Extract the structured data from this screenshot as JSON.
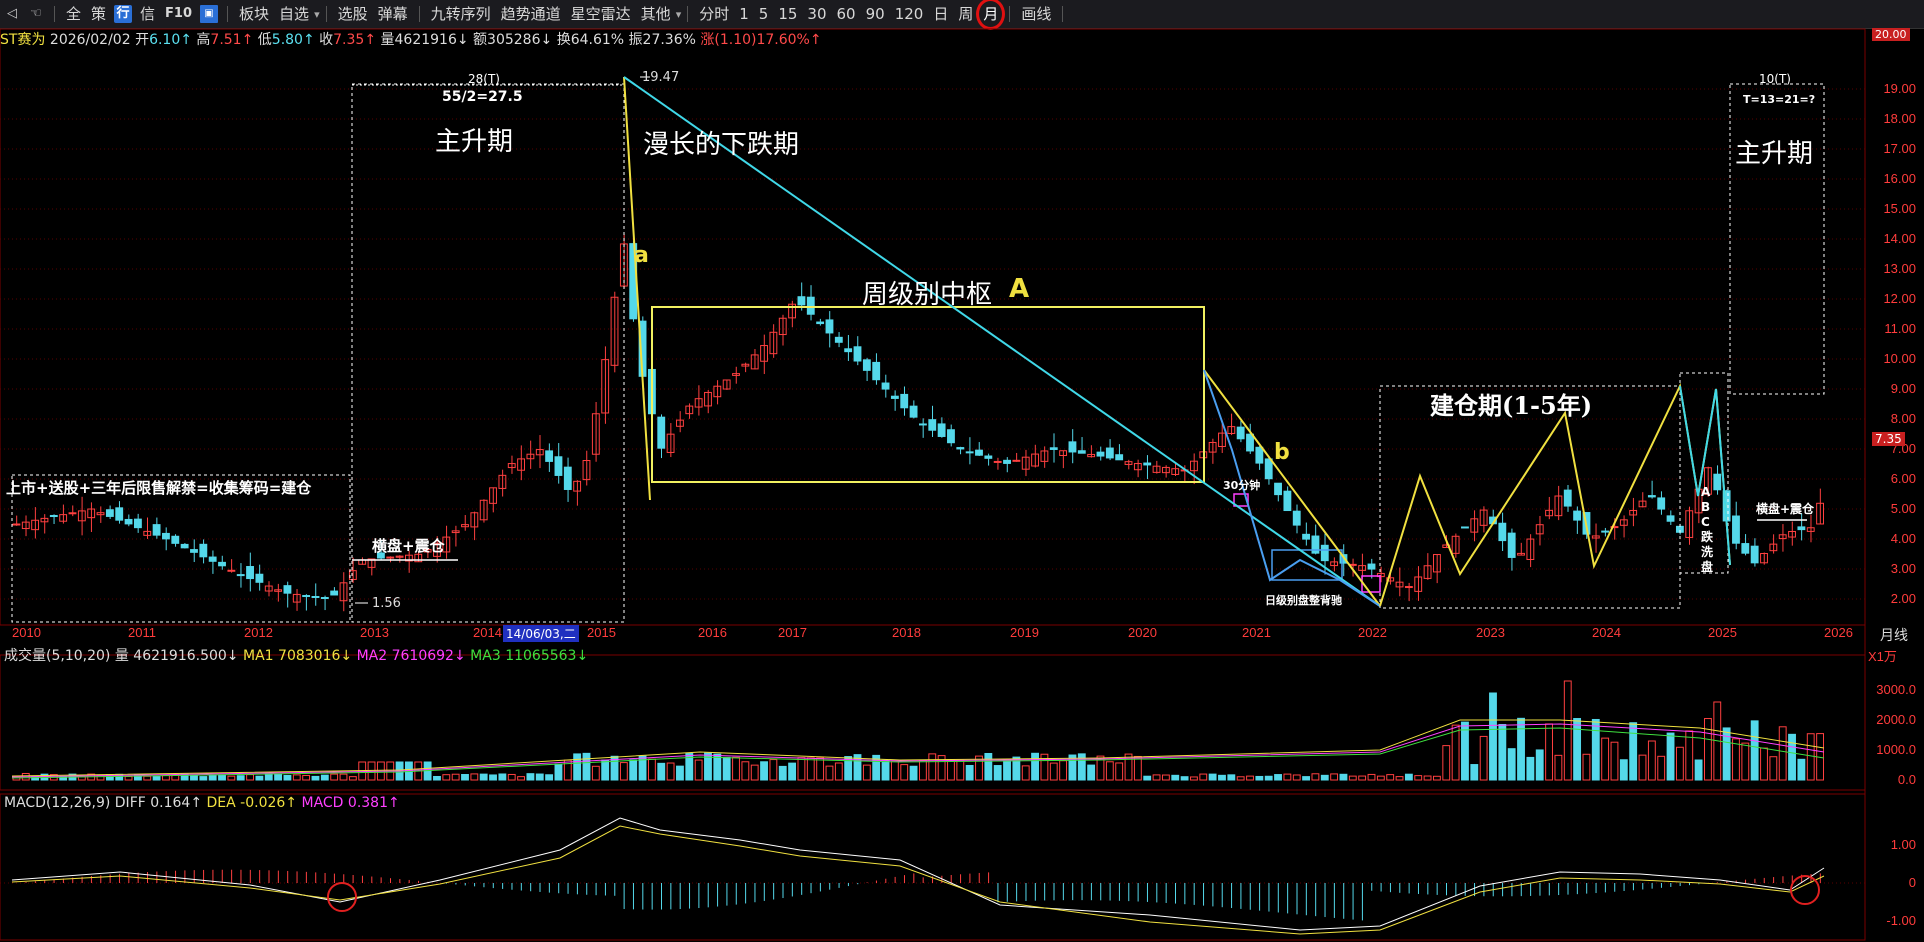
{
  "toolbar": {
    "items": [
      "全",
      "策",
      "行",
      "信",
      "F10",
      "选",
      "板块",
      "自选",
      "选股",
      "弹幕",
      "九转序列",
      "趋势通道",
      "星空雷达",
      "其他",
      "分时",
      "1",
      "5",
      "15",
      "30",
      "60",
      "90",
      "120",
      "日",
      "周",
      "月",
      "画线"
    ]
  },
  "info": {
    "name": "ST赛为",
    "date": "2026/02/02",
    "open_label": "开",
    "open": "6.10↑",
    "high_label": "高",
    "high": "7.51↑",
    "low_label": "低",
    "low": "5.80↑",
    "close_label": "收",
    "close": "7.35↑",
    "vol_label": "量",
    "vol": "4621916↓",
    "amt_label": "额",
    "amt": "305286↓",
    "turn_label": "换",
    "turn": "64.61%",
    "amp_label": "振",
    "amp": "27.36%",
    "chg_label": "涨",
    "chg": "(1.10)17.60%↑"
  },
  "price_axis": {
    "ticks": [
      "19.00",
      "18.00",
      "17.00",
      "16.00",
      "15.00",
      "14.00",
      "13.00",
      "12.00",
      "11.00",
      "10.00",
      "9.00",
      "8.00",
      "7.00",
      "6.00",
      "5.00",
      "4.00",
      "3.00",
      "2.00"
    ],
    "current_price": "7.35",
    "top_value": "20.00"
  },
  "time_axis": {
    "years": [
      "2010",
      "2011",
      "2012",
      "2013",
      "2014",
      "2015",
      "2016",
      "2017",
      "2018",
      "2019",
      "2020",
      "2021",
      "2022",
      "2023",
      "2024",
      "2025",
      "2026"
    ],
    "cursor_date": "14/06/03,二",
    "period_label": "月线"
  },
  "annotations": {
    "main_rise_1": "主升期",
    "long_decline": "漫长的下跌期",
    "weekly_pivot": "周级别中枢",
    "pivot_letter": "A",
    "accumulation": "建仓期(1-5年)",
    "main_rise_2": "主升期",
    "listing_note": "上市+送股+三年后限售解禁=收集筹码=建仓",
    "sideways_1": "横盘+震仓",
    "sideways_2": "横盘+震仓",
    "leg_a": "a",
    "leg_b": "b",
    "count_28": "28(T)",
    "calc_28": "55/2=27.5",
    "count_10": "10(T)",
    "calc_10": "T=13=21=?",
    "peak_price": "19.47",
    "low_price": "1.56",
    "min30": "30分钟",
    "daily_div": "日级别盘整背驰",
    "abc_wash": "ABC跌洗盘"
  },
  "volume": {
    "title": "成交量(5,10,20)",
    "vol_label": "量",
    "vol_value": "4621916.500↓",
    "ma1_label": "MA1",
    "ma1_value": "7083016↓",
    "ma2_label": "MA2",
    "ma2_value": "7610692↓",
    "ma3_label": "MA3",
    "ma3_value": "11065563↓",
    "unit": "X1万",
    "ticks": [
      "3000.0",
      "2000.0",
      "1000.0",
      "0.0"
    ]
  },
  "macd": {
    "title": "MACD(12,26,9)",
    "diff_label": "DIFF",
    "diff_value": "0.164↑",
    "dea_label": "DEA",
    "dea_value": "-0.026↑",
    "macd_label": "MACD",
    "macd_value": "0.381↑",
    "ticks": [
      "1.00",
      "0",
      "-1.00"
    ]
  },
  "colors": {
    "up": "#ff4040",
    "down": "#54d8ea",
    "yellow": "#f0e040",
    "cyan": "#40d8e8",
    "grid": "#5a0000"
  }
}
